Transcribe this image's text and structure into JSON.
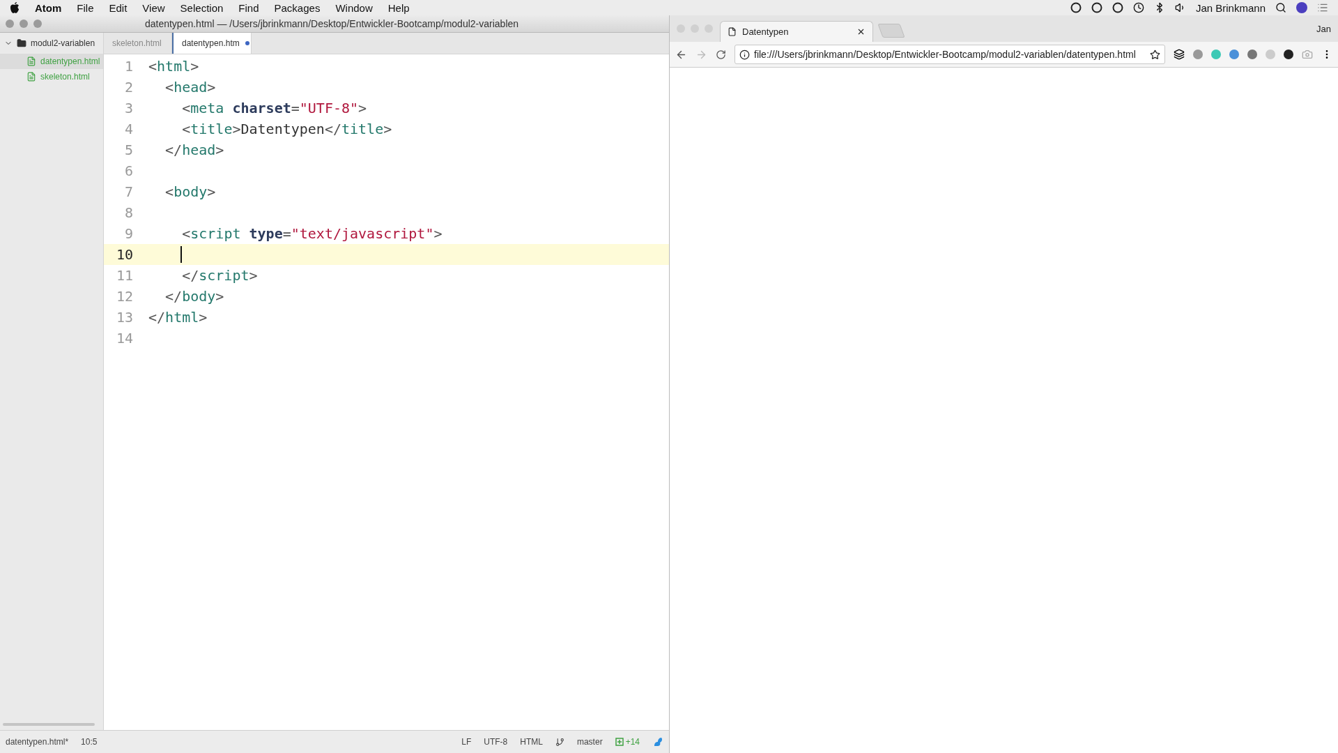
{
  "menubar": {
    "app": "Atom",
    "menus": [
      "File",
      "Edit",
      "View",
      "Selection",
      "Find",
      "Packages",
      "Window",
      "Help"
    ],
    "user": "Jan Brinkmann"
  },
  "atom": {
    "title": "datentypen.html — /Users/jbrinkmann/Desktop/Entwickler-Bootcamp/modul2-variablen",
    "tree": {
      "name": "modul2-variablen",
      "expanded": true,
      "children": [
        {
          "name": "datentypen.html",
          "selected": true
        },
        {
          "name": "skeleton.html",
          "selected": false
        }
      ]
    },
    "tabs": [
      {
        "label": "skeleton.html",
        "selected": false,
        "modified": false
      },
      {
        "label": "datentypen.htm",
        "selected": true,
        "modified": true
      }
    ],
    "lines": [
      {
        "number": "1",
        "current": false,
        "tokens": [
          {
            "kind": "punct",
            "text": "<"
          },
          {
            "kind": "tag",
            "text": "html"
          },
          {
            "kind": "punct",
            "text": ">"
          }
        ]
      },
      {
        "number": "2",
        "current": false,
        "tokens": [
          {
            "kind": "punct",
            "text": "  <"
          },
          {
            "kind": "tag",
            "text": "head"
          },
          {
            "kind": "punct",
            "text": ">"
          }
        ]
      },
      {
        "number": "3",
        "current": false,
        "tokens": [
          {
            "kind": "punct",
            "text": "    <"
          },
          {
            "kind": "tag",
            "text": "meta "
          },
          {
            "kind": "attr",
            "text": "charset"
          },
          {
            "kind": "punct",
            "text": "="
          },
          {
            "kind": "string",
            "text": "\"UTF-8\""
          },
          {
            "kind": "punct",
            "text": ">"
          }
        ]
      },
      {
        "number": "4",
        "current": false,
        "tokens": [
          {
            "kind": "punct",
            "text": "    <"
          },
          {
            "kind": "tag",
            "text": "title"
          },
          {
            "kind": "punct",
            "text": ">"
          },
          {
            "kind": "text",
            "text": "Datentypen"
          },
          {
            "kind": "punct",
            "text": "</"
          },
          {
            "kind": "tag",
            "text": "title"
          },
          {
            "kind": "punct",
            "text": ">"
          }
        ]
      },
      {
        "number": "5",
        "current": false,
        "tokens": [
          {
            "kind": "punct",
            "text": "  </"
          },
          {
            "kind": "tag",
            "text": "head"
          },
          {
            "kind": "punct",
            "text": ">"
          }
        ]
      },
      {
        "number": "6",
        "current": false
      },
      {
        "number": "7",
        "current": false,
        "tokens": [
          {
            "kind": "punct",
            "text": "  <"
          },
          {
            "kind": "tag",
            "text": "body"
          },
          {
            "kind": "punct",
            "text": ">"
          }
        ]
      },
      {
        "number": "8",
        "current": false
      },
      {
        "number": "9",
        "current": false,
        "tokens": [
          {
            "kind": "punct",
            "text": "    <"
          },
          {
            "kind": "tag",
            "text": "script "
          },
          {
            "kind": "attr",
            "text": "type"
          },
          {
            "kind": "punct",
            "text": "="
          },
          {
            "kind": "string",
            "text": "\"text/javascript\""
          },
          {
            "kind": "punct",
            "text": ">"
          }
        ]
      },
      {
        "number": "10",
        "current": true
      },
      {
        "number": "11",
        "current": false,
        "tokens": [
          {
            "kind": "punct",
            "text": "    </"
          },
          {
            "kind": "tag",
            "text": "script"
          },
          {
            "kind": "punct",
            "text": ">"
          }
        ]
      },
      {
        "number": "12",
        "current": false,
        "tokens": [
          {
            "kind": "punct",
            "text": "  </"
          },
          {
            "kind": "tag",
            "text": "body"
          },
          {
            "kind": "punct",
            "text": ">"
          }
        ]
      },
      {
        "number": "13",
        "current": false,
        "tokens": [
          {
            "kind": "punct",
            "text": "</"
          },
          {
            "kind": "tag",
            "text": "html"
          },
          {
            "kind": "punct",
            "text": ">"
          }
        ]
      },
      {
        "number": "14",
        "current": false
      }
    ],
    "status": {
      "file": "datentypen.html*",
      "position": "10:5",
      "line_ending": "LF",
      "encoding": "UTF-8",
      "grammar": "HTML",
      "branch": "master",
      "changes": "+14"
    }
  },
  "browser": {
    "tab": "Datentypen",
    "profile": "Jan",
    "url": "file:///Users/jbrinkmann/Desktop/Entwickler-Bootcamp/modul2-variablen/datentypen.html"
  }
}
